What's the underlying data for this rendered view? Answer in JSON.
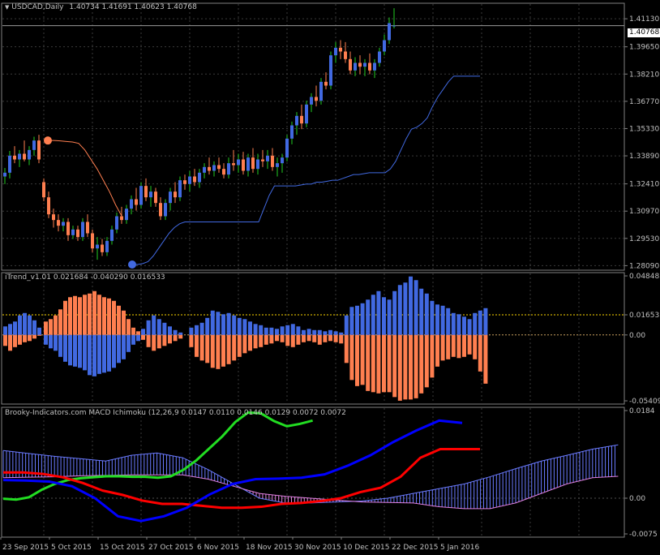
{
  "colors": {
    "background": "#000000",
    "grid": "#3a3a3a",
    "text": "#c0c0c0",
    "bull": "#4169e1",
    "bear": "#ff7f50",
    "wick_bull": "#22cc22",
    "wick_bear": "#ff7f50",
    "sar_up": "#4169e1",
    "sar_down": "#ff7f50",
    "macd_green": "#22dd22",
    "macd_red": "#ff0000",
    "macd_blue": "#0000ff",
    "kumo_blue": "#6a7aff",
    "kumo_pink": "#e080e0",
    "hline_yellow": "#ffd700"
  },
  "header": {
    "title": "USDCAD,Daily",
    "ohlc": "1.40734 1.41691 1.40623 1.40768"
  },
  "indicator1": {
    "title": "iTrend_v1.01 0.021684 -0.040290 0.016533"
  },
  "indicator2": {
    "title": "Brooky-Indicators.com MACD Ichimoku (12,26,9 0.0147 0.0110 0.0146 0.0129 0.0072 0.0072"
  },
  "price_axis": {
    "labels": [
      "1.41130",
      "1.39650",
      "1.38210",
      "1.36770",
      "1.35330",
      "1.33890",
      "1.32410",
      "1.30970",
      "1.29530",
      "1.28090"
    ],
    "current": "1.40768"
  },
  "itrend_axis": {
    "labels": [
      "0.048485",
      "0.016533",
      "0.00",
      "-0.054093"
    ]
  },
  "macd_axis": {
    "labels": [
      "0.0184",
      "0.00",
      "-0.0075"
    ]
  },
  "time_axis": {
    "labels": [
      "23 Sep 2015",
      "5 Oct 2015",
      "15 Oct 2015",
      "27 Oct 2015",
      "6 Nov 2015",
      "18 Nov 2015",
      "30 Nov 2015",
      "10 Dec 2015",
      "22 Dec 2015",
      "5 Jan 2016"
    ]
  },
  "chart_data": [
    {
      "type": "candlestick",
      "symbol": "USDCAD,Daily",
      "ylim": [
        1.2785,
        1.4195
      ],
      "candles": [
        [
          1.328,
          1.3325,
          1.324,
          1.33
        ],
        [
          1.33,
          1.3415,
          1.327,
          1.339
        ],
        [
          1.339,
          1.344,
          1.335,
          1.337
        ],
        [
          1.337,
          1.342,
          1.333,
          1.34
        ],
        [
          1.34,
          1.347,
          1.336,
          1.337
        ],
        [
          1.337,
          1.344,
          1.334,
          1.342
        ],
        [
          1.342,
          1.349,
          1.339,
          1.347
        ],
        [
          1.347,
          1.35,
          1.335,
          1.337
        ],
        [
          1.325,
          1.327,
          1.315,
          1.317
        ],
        [
          1.317,
          1.32,
          1.306,
          1.308
        ],
        [
          1.308,
          1.311,
          1.301,
          1.305
        ],
        [
          1.305,
          1.308,
          1.299,
          1.302
        ],
        [
          1.302,
          1.306,
          1.299,
          1.304
        ],
        [
          1.304,
          1.306,
          1.294,
          1.297
        ],
        [
          1.297,
          1.302,
          1.295,
          1.3
        ],
        [
          1.3,
          1.302,
          1.294,
          1.296
        ],
        [
          1.296,
          1.306,
          1.294,
          1.304
        ],
        [
          1.304,
          1.308,
          1.296,
          1.298
        ],
        [
          1.298,
          1.3,
          1.288,
          1.29
        ],
        [
          1.29,
          1.296,
          1.284,
          1.292
        ],
        [
          1.292,
          1.295,
          1.286,
          1.288
        ],
        [
          1.288,
          1.296,
          1.286,
          1.294
        ],
        [
          1.294,
          1.302,
          1.292,
          1.3
        ],
        [
          1.3,
          1.309,
          1.298,
          1.307
        ],
        [
          1.307,
          1.312,
          1.303,
          1.305
        ],
        [
          1.305,
          1.313,
          1.303,
          1.311
        ],
        [
          1.311,
          1.318,
          1.308,
          1.316
        ],
        [
          1.316,
          1.322,
          1.31,
          1.313
        ],
        [
          1.313,
          1.325,
          1.311,
          1.323
        ],
        [
          1.323,
          1.327,
          1.315,
          1.317
        ],
        [
          1.317,
          1.323,
          1.312,
          1.32
        ],
        [
          1.32,
          1.322,
          1.312,
          1.314
        ],
        [
          1.314,
          1.317,
          1.305,
          1.307
        ],
        [
          1.307,
          1.316,
          1.305,
          1.314
        ],
        [
          1.314,
          1.322,
          1.31,
          1.32
        ],
        [
          1.32,
          1.325,
          1.314,
          1.317
        ],
        [
          1.317,
          1.328,
          1.315,
          1.326
        ],
        [
          1.326,
          1.329,
          1.321,
          1.324
        ],
        [
          1.324,
          1.331,
          1.32,
          1.328
        ],
        [
          1.328,
          1.332,
          1.323,
          1.325
        ],
        [
          1.325,
          1.332,
          1.322,
          1.33
        ],
        [
          1.33,
          1.335,
          1.327,
          1.333
        ],
        [
          1.333,
          1.338,
          1.329,
          1.331
        ],
        [
          1.331,
          1.336,
          1.328,
          1.334
        ],
        [
          1.334,
          1.338,
          1.33,
          1.332
        ],
        [
          1.332,
          1.335,
          1.327,
          1.329
        ],
        [
          1.329,
          1.338,
          1.327,
          1.335
        ],
        [
          1.335,
          1.342,
          1.331,
          1.334
        ],
        [
          1.334,
          1.34,
          1.33,
          1.337
        ],
        [
          1.337,
          1.341,
          1.329,
          1.331
        ],
        [
          1.331,
          1.34,
          1.328,
          1.338
        ],
        [
          1.338,
          1.343,
          1.33,
          1.332
        ],
        [
          1.332,
          1.34,
          1.329,
          1.337
        ],
        [
          1.337,
          1.342,
          1.333,
          1.336
        ],
        [
          1.336,
          1.342,
          1.332,
          1.339
        ],
        [
          1.339,
          1.343,
          1.331,
          1.333
        ],
        [
          1.333,
          1.338,
          1.328,
          1.335
        ],
        [
          1.335,
          1.34,
          1.33,
          1.338
        ],
        [
          1.338,
          1.35,
          1.336,
          1.348
        ],
        [
          1.348,
          1.357,
          1.345,
          1.355
        ],
        [
          1.355,
          1.362,
          1.35,
          1.36
        ],
        [
          1.36,
          1.366,
          1.353,
          1.356
        ],
        [
          1.356,
          1.368,
          1.354,
          1.366
        ],
        [
          1.366,
          1.372,
          1.362,
          1.37
        ],
        [
          1.37,
          1.376,
          1.365,
          1.368
        ],
        [
          1.368,
          1.38,
          1.366,
          1.378
        ],
        [
          1.378,
          1.383,
          1.374,
          1.376
        ],
        [
          1.376,
          1.394,
          1.374,
          1.392
        ],
        [
          1.392,
          1.399,
          1.388,
          1.396
        ],
        [
          1.396,
          1.4,
          1.39,
          1.394
        ],
        [
          1.394,
          1.399,
          1.388,
          1.39
        ],
        [
          1.39,
          1.394,
          1.382,
          1.384
        ],
        [
          1.384,
          1.391,
          1.381,
          1.388
        ],
        [
          1.388,
          1.392,
          1.382,
          1.386
        ],
        [
          1.386,
          1.39,
          1.381,
          1.388
        ],
        [
          1.388,
          1.393,
          1.382,
          1.384
        ],
        [
          1.384,
          1.39,
          1.38,
          1.388
        ],
        [
          1.388,
          1.396,
          1.386,
          1.394
        ],
        [
          1.394,
          1.403,
          1.392,
          1.4
        ],
        [
          1.4,
          1.412,
          1.398,
          1.409
        ],
        [
          1.4073,
          1.4169,
          1.4062,
          1.4077
        ]
      ],
      "sar_down": [
        1.347,
        1.347,
        1.3468,
        1.3465,
        1.3462,
        1.3455,
        1.342,
        1.337,
        1.332,
        1.326,
        1.32,
        1.313,
        1.307
      ],
      "sar_up": [
        1.2815,
        1.2815,
        1.282,
        1.283,
        1.286,
        1.29,
        1.294,
        1.298,
        1.301,
        1.303,
        1.304,
        1.304,
        1.304,
        1.304,
        1.304,
        1.304,
        1.304,
        1.304,
        1.304,
        1.304,
        1.304,
        1.304,
        1.304,
        1.304,
        1.304,
        1.311,
        1.318,
        1.323,
        1.323,
        1.323,
        1.323,
        1.323,
        1.3235,
        1.324,
        1.324,
        1.325,
        1.325,
        1.3255,
        1.326,
        1.326,
        1.327,
        1.328,
        1.329,
        1.329,
        1.3295,
        1.33,
        1.33,
        1.33,
        1.33,
        1.332,
        1.336,
        1.342,
        1.348,
        1.353,
        1.354,
        1.356,
        1.359,
        1.365,
        1.37,
        1.374,
        1.378,
        1.381,
        1.381,
        1.381,
        1.381,
        1.381,
        1.381
      ]
    },
    {
      "type": "bar",
      "name": "iTrend_v1.01",
      "ylim": [
        -0.0541,
        0.0485
      ],
      "levels": [
        0.016533,
        0.0
      ],
      "bull": [
        0.007,
        0.009,
        0.011,
        0.016,
        0.018,
        0.016,
        0.012,
        0.006,
        0.0,
        0.0,
        0.0,
        0.0,
        0.0,
        0.0,
        0.0,
        0.0,
        0.0,
        0.0,
        0.0,
        0.0,
        0.0,
        0.0,
        0.0,
        0.0,
        0.0,
        0.0,
        0.0,
        0.0,
        0.005,
        0.012,
        0.016,
        0.013,
        0.01,
        0.007,
        0.004,
        0.002,
        0.0,
        0.006,
        0.008,
        0.01,
        0.014,
        0.02,
        0.019,
        0.017,
        0.018,
        0.016,
        0.014,
        0.013,
        0.011,
        0.009,
        0.008,
        0.006,
        0.006,
        0.005,
        0.007,
        0.008,
        0.009,
        0.007,
        0.004,
        0.005,
        0.004,
        0.004,
        0.003,
        0.004,
        0.003,
        0.002,
        0.016,
        0.023,
        0.024,
        0.026,
        0.029,
        0.033,
        0.036,
        0.031,
        0.029,
        0.036,
        0.041,
        0.043,
        0.048,
        0.045,
        0.038,
        0.034,
        0.028,
        0.025,
        0.024,
        0.022,
        0.018,
        0.017,
        0.015,
        0.013,
        0.018,
        0.02,
        0.022
      ],
      "bear": [
        -0.009,
        -0.013,
        -0.01,
        -0.008,
        -0.006,
        -0.005,
        -0.003,
        0.0,
        0.0,
        0.0,
        0.0,
        0.0,
        0.0,
        0.0,
        0.0,
        0.0,
        0.0,
        0.0,
        0.0,
        0.0,
        0.0,
        0.0,
        0.0,
        0.0,
        0.0,
        0.0,
        0.0,
        0.0,
        -0.004,
        -0.01,
        -0.013,
        -0.011,
        -0.009,
        -0.007,
        -0.005,
        -0.003,
        0.0,
        -0.01,
        -0.018,
        -0.021,
        -0.023,
        -0.027,
        -0.028,
        -0.026,
        -0.024,
        -0.021,
        -0.018,
        -0.015,
        -0.013,
        -0.011,
        -0.01,
        -0.008,
        -0.007,
        -0.005,
        -0.006,
        -0.009,
        -0.01,
        -0.008,
        -0.006,
        -0.005,
        -0.006,
        -0.008,
        -0.006,
        -0.005,
        -0.006,
        -0.007,
        -0.023,
        -0.037,
        -0.042,
        -0.041,
        -0.046,
        -0.047,
        -0.048,
        -0.047,
        -0.047,
        -0.051,
        -0.054,
        -0.053,
        -0.053,
        -0.052,
        -0.048,
        -0.043,
        -0.035,
        -0.026,
        -0.021,
        -0.02,
        -0.018,
        -0.019,
        -0.018,
        -0.016,
        -0.02,
        -0.03,
        -0.04
      ],
      "bull_early": [
        0.011,
        0.013,
        0.016,
        0.021,
        0.028,
        0.031,
        0.032,
        0.031,
        0.033,
        0.034,
        0.036,
        0.033,
        0.031,
        0.03,
        0.028,
        0.024,
        0.02,
        0.013,
        0.006,
        0.003
      ],
      "bear_early": [
        -0.008,
        -0.011,
        -0.013,
        -0.018,
        -0.022,
        -0.025,
        -0.026,
        -0.027,
        -0.029,
        -0.033,
        -0.034,
        -0.032,
        -0.031,
        -0.03,
        -0.027,
        -0.023,
        -0.02,
        -0.014,
        -0.008,
        -0.005
      ]
    },
    {
      "type": "line",
      "name": "MACD Ichimoku",
      "ylim": [
        -0.0075,
        0.0184
      ],
      "series": [
        {
          "color": "green",
          "values": [
            -0.0001,
            -0.0003,
            0.0002,
            0.0018,
            0.003,
            0.0038,
            0.0042,
            0.0044,
            0.0046,
            0.0046,
            0.0045,
            0.0045,
            0.0043,
            0.0046,
            0.006,
            0.008,
            0.0105,
            0.013,
            0.016,
            0.018,
            0.0178,
            0.0162,
            0.0151,
            0.0156,
            0.0163
          ]
        },
        {
          "color": "red",
          "values": [
            0.0054,
            0.0054,
            0.0051,
            0.0044,
            0.0032,
            0.0016,
            0.0007,
            -0.0005,
            -0.0012,
            -0.0012,
            -0.0016,
            -0.002,
            -0.002,
            -0.0018,
            -0.0012,
            -0.001,
            -0.0006,
            0.0,
            0.0013,
            0.0022,
            0.0045,
            0.0085,
            0.0103,
            0.0103,
            0.0103
          ]
        },
        {
          "color": "blue",
          "values": [
            0.0038,
            0.0037,
            0.0035,
            0.0025,
            0.0,
            -0.0038,
            -0.0048,
            -0.0038,
            -0.002,
            0.0008,
            0.003,
            0.004,
            0.0041,
            0.0043,
            0.005,
            0.0068,
            0.009,
            0.0118,
            0.0142,
            0.0163,
            0.0158
          ]
        }
      ],
      "kumo_top": [
        0.01,
        0.0094,
        0.0088,
        0.0083,
        0.0078,
        0.009,
        0.0095,
        0.0085,
        0.006,
        0.003,
        0.0,
        -0.001,
        -0.001,
        -0.0008,
        -0.0006,
        0.0,
        0.001,
        0.002,
        0.003,
        0.0045,
        0.0062,
        0.0078,
        0.009,
        0.0103,
        0.0112
      ],
      "kumo_bottom": [
        0.0043,
        0.0044,
        0.0045,
        0.0047,
        0.0048,
        0.0049,
        0.0049,
        0.0049,
        0.004,
        0.0025,
        0.001,
        0.0004,
        0.0,
        -0.0004,
        -0.0008,
        -0.0009,
        -0.001,
        -0.0018,
        -0.0022,
        -0.0022,
        -0.001,
        0.001,
        0.003,
        0.0043,
        0.0046
      ]
    }
  ]
}
